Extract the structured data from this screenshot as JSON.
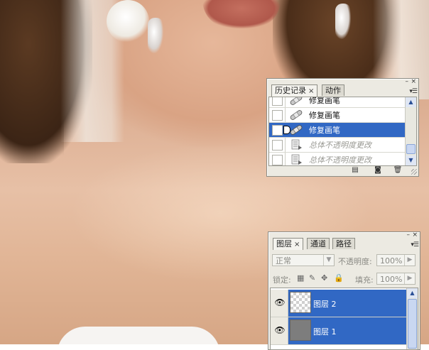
{
  "history_panel": {
    "tabs": [
      {
        "label": "历史记录",
        "active": true
      },
      {
        "label": "动作",
        "active": false
      }
    ],
    "items": [
      {
        "label": "修复画笔",
        "icon": "healing-brush-icon",
        "selected": false,
        "dimmed": false
      },
      {
        "label": "修复画笔",
        "icon": "healing-brush-icon",
        "selected": false,
        "dimmed": false
      },
      {
        "label": "修复画笔",
        "icon": "healing-brush-icon",
        "selected": true,
        "dimmed": false
      },
      {
        "label": "总体不透明度更改",
        "icon": "document-step-icon",
        "selected": false,
        "dimmed": true
      },
      {
        "label": "总体不透明度更改",
        "icon": "document-step-icon",
        "selected": false,
        "dimmed": true
      }
    ],
    "footer_icons": [
      "new-document-from-state-icon",
      "snapshot-icon",
      "trash-icon"
    ]
  },
  "layers_panel": {
    "tabs": [
      {
        "label": "图层",
        "active": true
      },
      {
        "label": "通道",
        "active": false
      },
      {
        "label": "路径",
        "active": false
      }
    ],
    "blend_mode": "正常",
    "opacity_label": "不透明度:",
    "opacity_value": "100%",
    "lock_label": "锁定:",
    "fill_label": "填充:",
    "fill_value": "100%",
    "layers": [
      {
        "name": "图层 2",
        "thumbnail": "transparent",
        "visible": true,
        "selected": true
      },
      {
        "name": "图层 1",
        "thumbnail": "gray",
        "visible": true,
        "selected": true
      }
    ]
  },
  "window_controls": {
    "close": "×",
    "minimize": "–",
    "close_tab": "×"
  },
  "colors": {
    "selection": "#3168c4",
    "panel_bg": "#eceae2"
  }
}
